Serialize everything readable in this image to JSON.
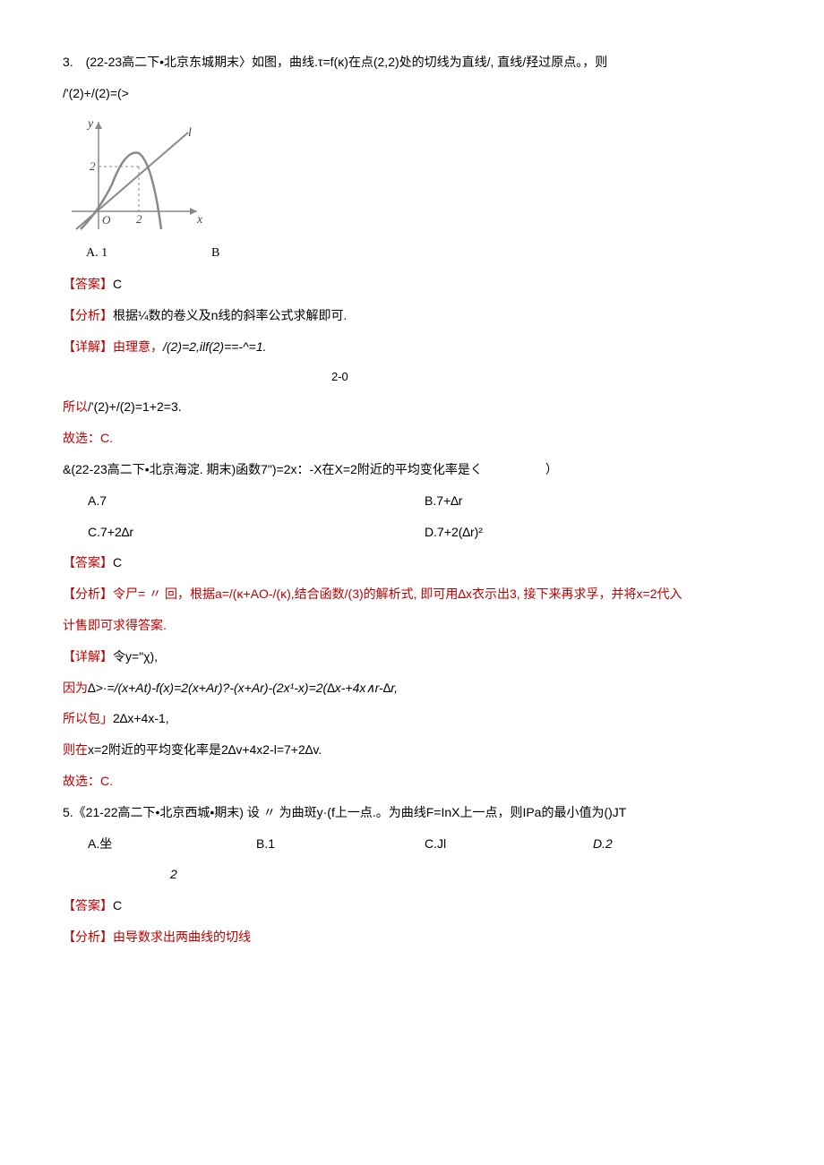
{
  "q3": {
    "stem": "3.　(22-23高二下•北京东城期末〉如图，曲线.τ=f(κ)在点(2,2)处的切线为直线/, 直线/羟过原点。，则",
    "stem2": "/'(2)+/(2)=(>",
    "optA": "A. 1",
    "optB": "B",
    "ans_label": "【答案】",
    "ans": "C",
    "ana_label": "【分析】",
    "ana": "根据¼数的卷义及n线的斜率公式求解即可.",
    "det_label": "【详解】",
    "det1a": "由理意，",
    "det1b": "/(2)=2,ilf(2)==-^=1.",
    "det1c": "2-0",
    "det2": "/'(2)+/(2)=1+2=3.",
    "so_lbl": "所以",
    "choose": "故选：C."
  },
  "q4": {
    "stem": "&(22-23高二下•北京海淀. 期末)函数7\")=2x：-X在X=2附近的平均变化率是く　　　　　）",
    "optA": "A.7",
    "optB": "B.7+∆r",
    "optC": "C.7+2∆r",
    "optD": "D.7+2(∆r)²",
    "ans_label": "【答案】",
    "ans": "C",
    "ana_label": "【分析】",
    "ana_a": "令尸= 〃 回，根据a=/(κ+AO-/(κ),结合函数/(3)的解析式, 即可用∆x衣示出3, 接下来再求孚，并将x=2代入",
    "ana_b": "计售即可求得答案.",
    "det_label": "【详解】",
    "det1": "令y=\"χ),",
    "det2a": "因为",
    "det2b": "∆>·=/(x+At)-f(x)=2(x+Ar)?-(x+Ar)-(2x¹-x)=2(∆x-+4x∧r-∆r,",
    "det3a": "所以包」",
    "det3b": "2∆x+4x-1,",
    "det4a": "则在",
    "det4b": "x=2附近的平均变化率是2∆v+4x2-l=7+2∆v.",
    "choose": "故选：C."
  },
  "q5": {
    "stem": "5.《21-22高二下•北京西城•期末) 设 〃 为曲斑y·(f上一点.。为曲线F=InX上一点，则IPa的最小值为()JT",
    "optA": "A.坐",
    "optA2": "2",
    "optB": "B.1",
    "optC": "C.Jl",
    "optD": "D.2",
    "ans_label": "【答案】",
    "ans": "C",
    "ana_label": "【分析】",
    "ana": "由导数求出两曲线的切线"
  }
}
